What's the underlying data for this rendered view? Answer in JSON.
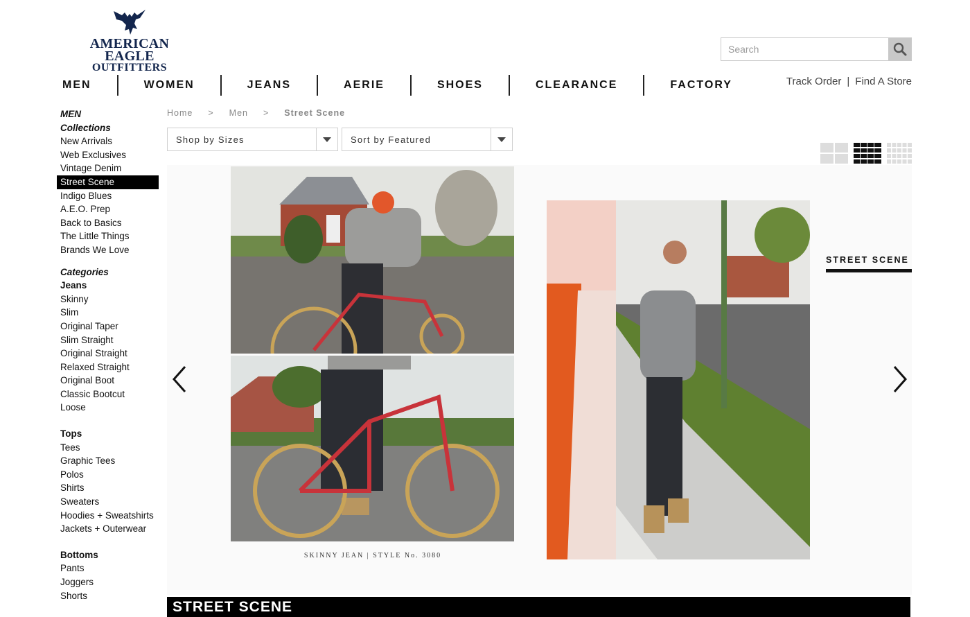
{
  "logo": {
    "line1": "AMERICAN EAGLE",
    "line2": "OUTFITTERS"
  },
  "search": {
    "placeholder": "Search",
    "icon": "magnifier-icon"
  },
  "nav": [
    "MEN",
    "WOMEN",
    "JEANS",
    "AERIE",
    "SHOES",
    "CLEARANCE",
    "FACTORY"
  ],
  "utility": {
    "track": "Track Order",
    "separator": "|",
    "find": "Find A Store"
  },
  "sidebar": {
    "section": "MEN",
    "collections_heading": "Collections",
    "collections": [
      "New Arrivals",
      "Web Exclusives",
      "Vintage Denim",
      "Street Scene",
      "Indigo Blues",
      "A.E.O. Prep",
      "Back to Basics",
      "The Little Things",
      "Brands We Love"
    ],
    "active": "Street Scene",
    "categories_heading": "Categories",
    "jeans_heading": "Jeans",
    "jeans": [
      "Skinny",
      "Slim",
      "Original Taper",
      "Slim Straight",
      "Original Straight",
      "Relaxed Straight",
      "Original Boot",
      "Classic Bootcut",
      "Loose"
    ],
    "tops_heading": "Tops",
    "tops": [
      "Tees",
      "Graphic Tees",
      "Polos",
      "Shirts",
      "Sweaters",
      "Hoodies + Sweatshirts",
      "Jackets + Outerwear"
    ],
    "bottoms_heading": "Bottoms",
    "bottoms": [
      "Pants",
      "Joggers",
      "Shorts"
    ]
  },
  "breadcrumb": {
    "home": "Home",
    "men": "Men",
    "current": "Street Scene",
    "sep": ">"
  },
  "filters": {
    "sizes": "Shop by Sizes",
    "sort": "Sort by Featured"
  },
  "views": [
    "grid-large-icon",
    "grid-medium-icon",
    "grid-small-icon"
  ],
  "feature": {
    "caption": "SKINNY JEAN | STYLE No. 3080",
    "side_label": "STREET SCENE",
    "prev": "chevron-left-icon",
    "next": "chevron-right-icon"
  },
  "banner": {
    "title": "STREET SCENE"
  },
  "colors": {
    "navy": "#13264d",
    "black": "#000000",
    "panel": "#fafafa"
  }
}
